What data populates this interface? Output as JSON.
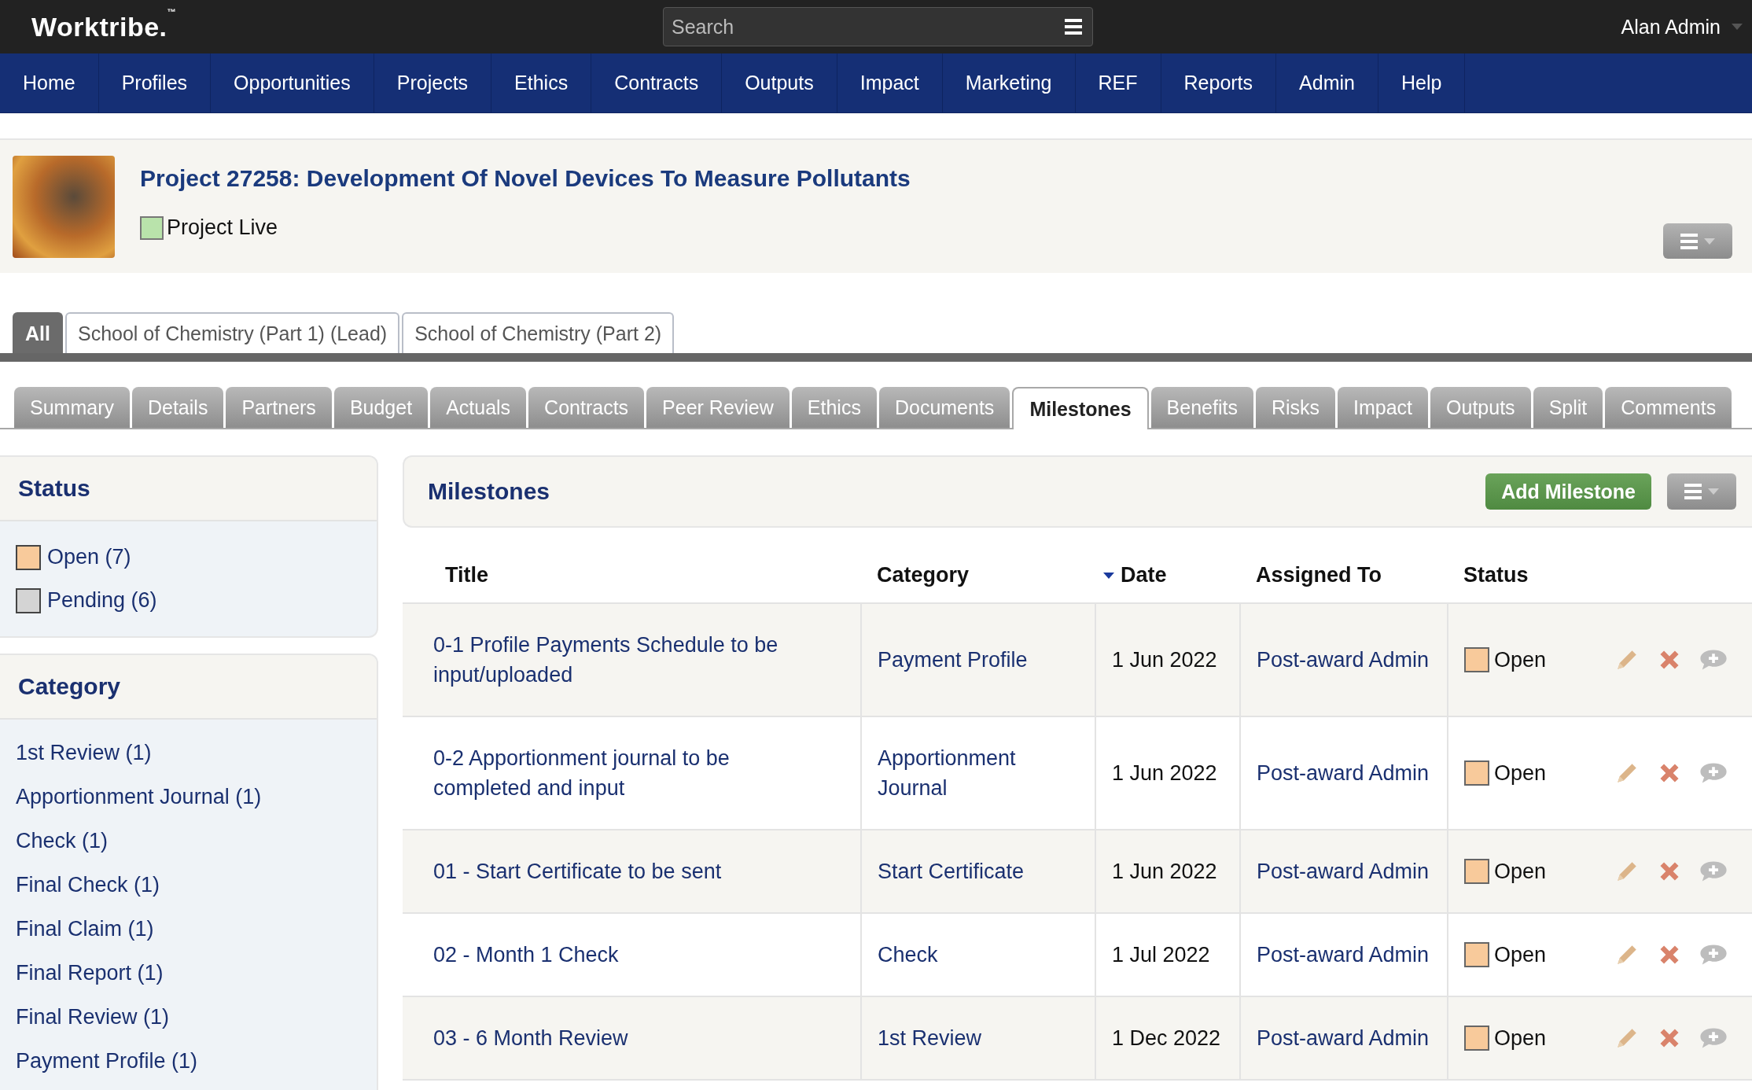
{
  "header": {
    "logo": "Worktribe.",
    "trademark": "™",
    "search": {
      "placeholder": "Search"
    },
    "user": "Alan Admin"
  },
  "nav": [
    "Home",
    "Profiles",
    "Opportunities",
    "Projects",
    "Ethics",
    "Contracts",
    "Outputs",
    "Impact",
    "Marketing",
    "REF",
    "Reports",
    "Admin",
    "Help"
  ],
  "project": {
    "title": "Project 27258: Development Of Novel Devices To Measure Pollutants",
    "status": {
      "label": "Project Live",
      "color": "#b9e3ab"
    }
  },
  "org_tabs": [
    {
      "label": "All",
      "selected": true
    },
    {
      "label": "School of Chemistry (Part 1) (Lead)",
      "selected": false
    },
    {
      "label": "School of Chemistry (Part 2)",
      "selected": false
    }
  ],
  "tabs": [
    {
      "label": "Summary",
      "selected": false
    },
    {
      "label": "Details",
      "selected": false
    },
    {
      "label": "Partners",
      "selected": false
    },
    {
      "label": "Budget",
      "selected": false
    },
    {
      "label": "Actuals",
      "selected": false
    },
    {
      "label": "Contracts",
      "selected": false
    },
    {
      "label": "Peer Review",
      "selected": false
    },
    {
      "label": "Ethics",
      "selected": false
    },
    {
      "label": "Documents",
      "selected": false
    },
    {
      "label": "Milestones",
      "selected": true
    },
    {
      "label": "Benefits",
      "selected": false
    },
    {
      "label": "Risks",
      "selected": false
    },
    {
      "label": "Impact",
      "selected": false
    },
    {
      "label": "Outputs",
      "selected": false
    },
    {
      "label": "Split",
      "selected": false
    },
    {
      "label": "Comments",
      "selected": false
    }
  ],
  "sidebar": {
    "status": {
      "title": "Status",
      "items": [
        {
          "label": "Open (7)",
          "color": "#f8ca9b"
        },
        {
          "label": "Pending (6)",
          "color": "#d4d4d4"
        }
      ]
    },
    "category": {
      "title": "Category",
      "items": [
        "1st Review (1)",
        "Apportionment Journal (1)",
        "Check (1)",
        "Final Check (1)",
        "Final Claim (1)",
        "Final Report (1)",
        "Final Review (1)",
        "Payment Profile (1)"
      ]
    }
  },
  "milestones": {
    "title": "Milestones",
    "add_button": "Add Milestone",
    "columns": [
      {
        "label": "Title",
        "sorted": false
      },
      {
        "label": "Category",
        "sorted": false
      },
      {
        "label": "Date",
        "sorted": true
      },
      {
        "label": "Assigned To",
        "sorted": false
      },
      {
        "label": "Status",
        "sorted": false
      }
    ],
    "rows": [
      {
        "title": "0-1 Profile Payments Schedule to be input/uploaded",
        "category": "Payment Profile",
        "date": "1 Jun 2022",
        "assigned_to": "Post-award Admin",
        "status": {
          "label": "Open",
          "color": "#f8ca9b"
        }
      },
      {
        "title": "0-2 Apportionment journal to be completed and input",
        "category": "Apportionment Journal",
        "date": "1 Jun 2022",
        "assigned_to": "Post-award Admin",
        "status": {
          "label": "Open",
          "color": "#f8ca9b"
        }
      },
      {
        "title": "01 - Start Certificate to be sent",
        "category": "Start Certificate",
        "date": "1 Jun 2022",
        "assigned_to": "Post-award Admin",
        "status": {
          "label": "Open",
          "color": "#f8ca9b"
        }
      },
      {
        "title": "02 - Month 1 Check",
        "category": "Check",
        "date": "1 Jul 2022",
        "assigned_to": "Post-award Admin",
        "status": {
          "label": "Open",
          "color": "#f8ca9b"
        }
      },
      {
        "title": "03 - 6 Month Review",
        "category": "1st Review",
        "date": "1 Dec 2022",
        "assigned_to": "Post-award Admin",
        "status": {
          "label": "Open",
          "color": "#f8ca9b"
        }
      }
    ]
  }
}
